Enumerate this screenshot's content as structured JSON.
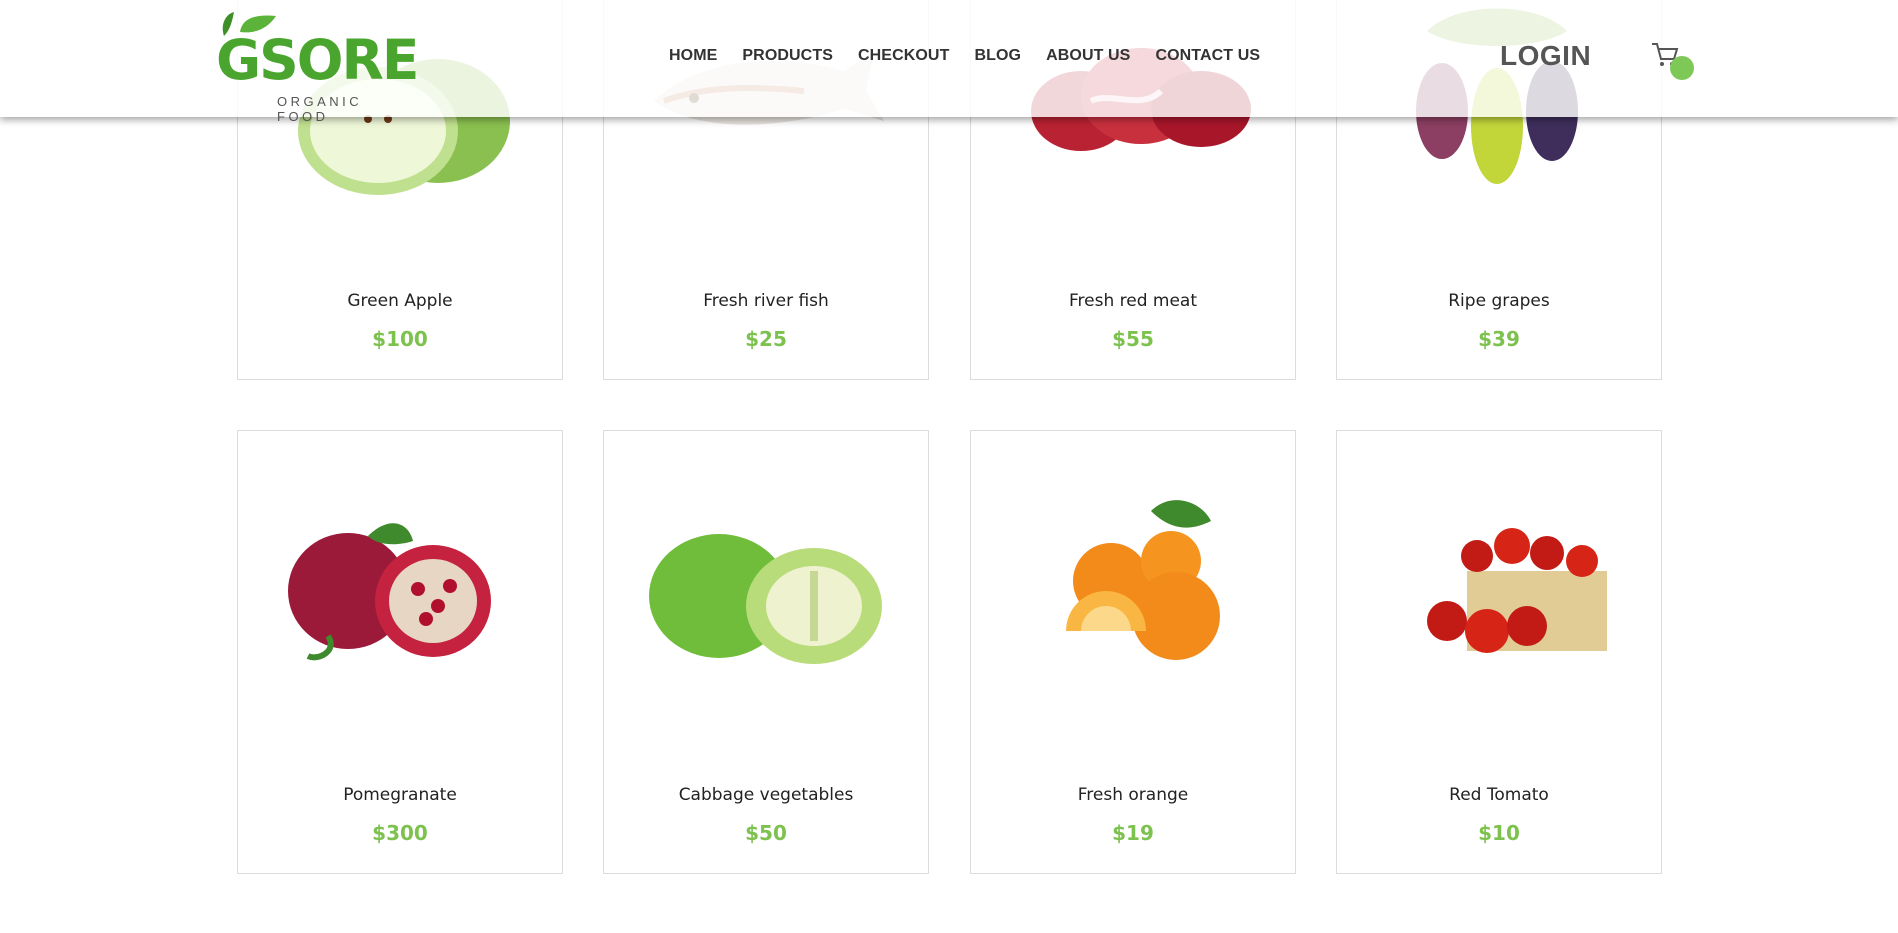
{
  "brand": {
    "name": "GSORE",
    "tagline": "ORGANIC FOOD",
    "colors": {
      "primary": "#4aa52e",
      "accent": "#7dc14f"
    }
  },
  "nav": {
    "items": [
      {
        "label": "HOME"
      },
      {
        "label": "PRODUCTS"
      },
      {
        "label": "CHECKOUT"
      },
      {
        "label": "BLOG"
      },
      {
        "label": "ABOUT US"
      },
      {
        "label": "CONTACT US"
      }
    ],
    "login_label": "LOGIN",
    "cart_icon": "cart-icon"
  },
  "products": [
    {
      "name": "Green Apple",
      "price": "$100",
      "image": "green-apple-image"
    },
    {
      "name": "Fresh river fish",
      "price": "$25",
      "image": "fish-image"
    },
    {
      "name": "Fresh red meat",
      "price": "$55",
      "image": "red-meat-image"
    },
    {
      "name": "Ripe grapes",
      "price": "$39",
      "image": "grapes-image"
    },
    {
      "name": "Pomegranate",
      "price": "$300",
      "image": "pomegranate-image"
    },
    {
      "name": "Cabbage vegetables",
      "price": "$50",
      "image": "cabbage-image"
    },
    {
      "name": "Fresh orange",
      "price": "$19",
      "image": "orange-image"
    },
    {
      "name": "Red Tomato",
      "price": "$10",
      "image": "tomato-image"
    }
  ]
}
